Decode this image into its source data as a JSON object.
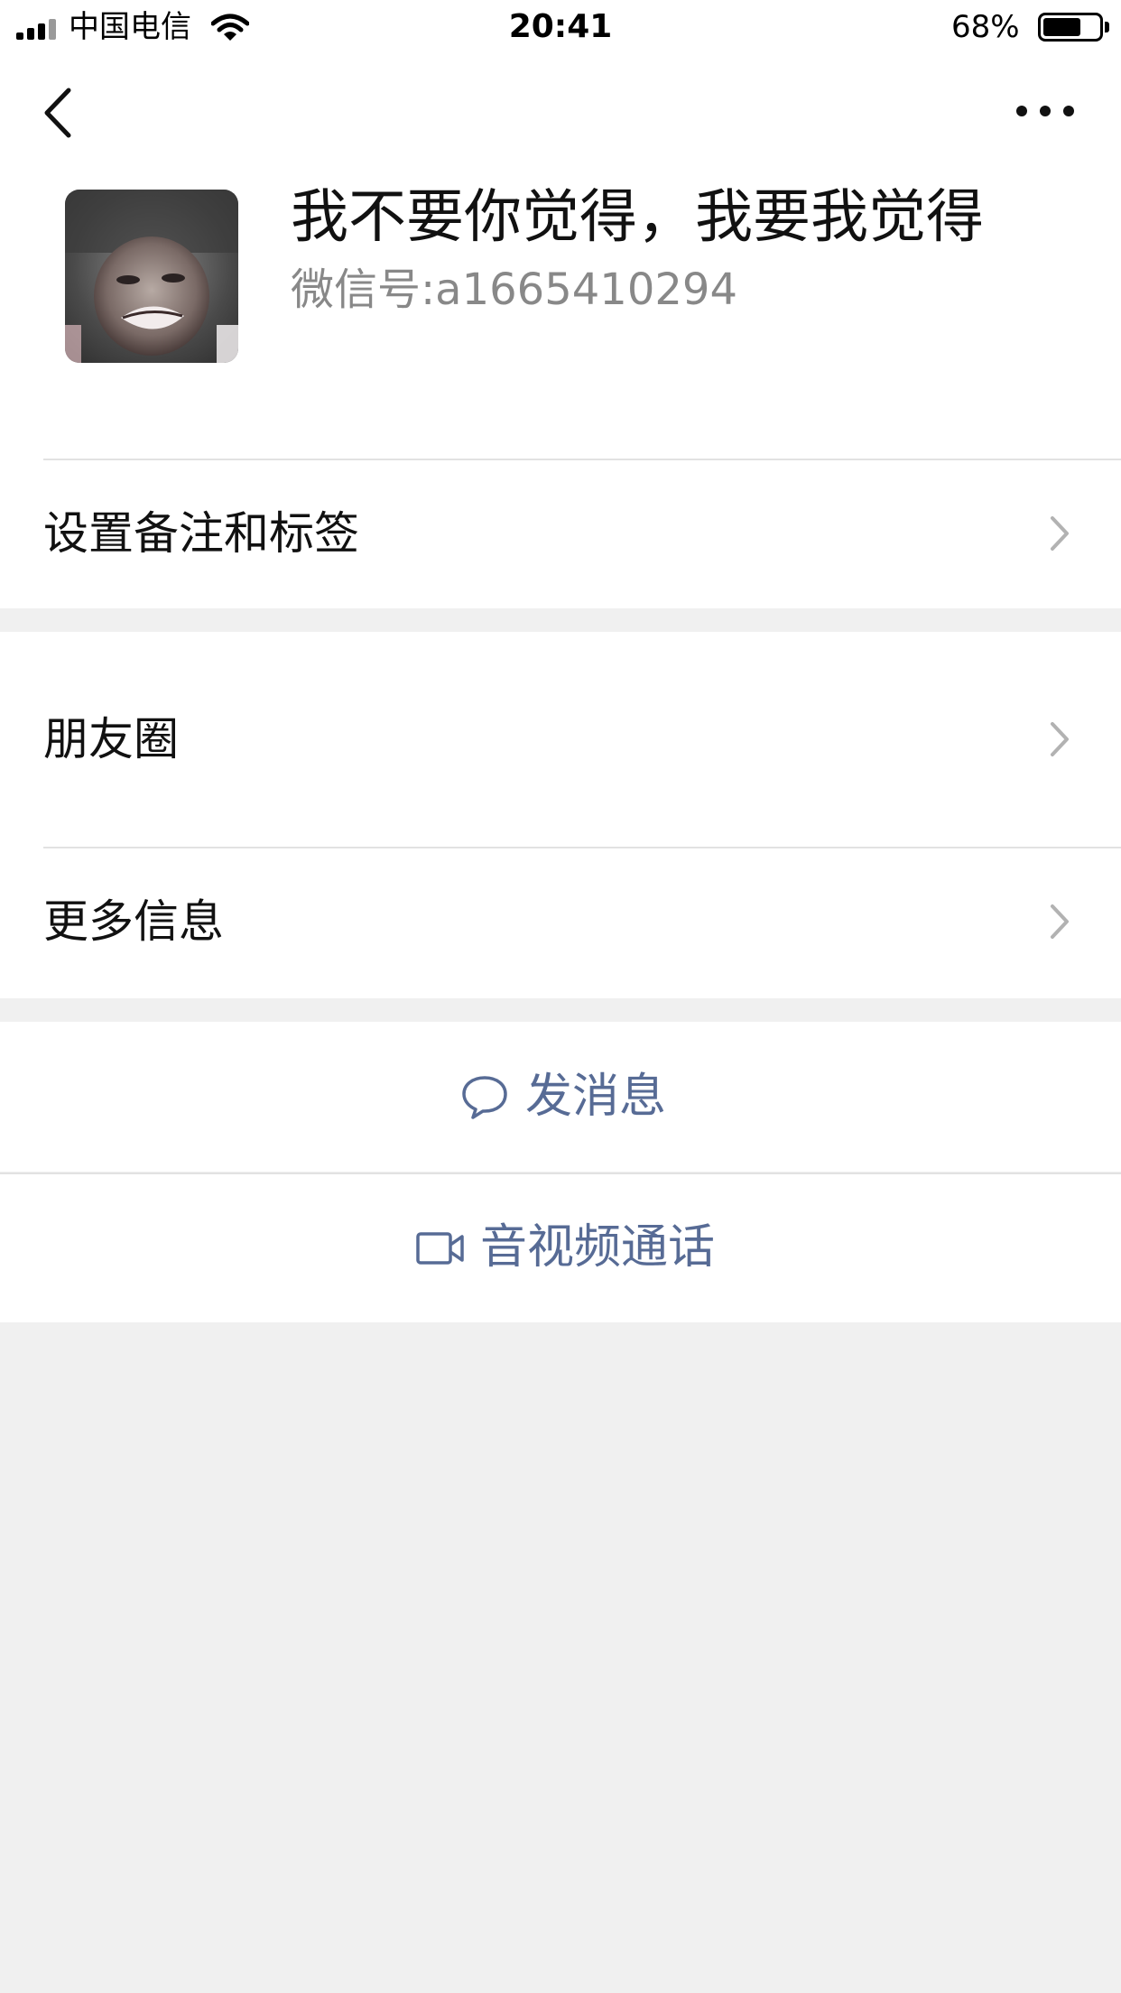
{
  "status_bar": {
    "carrier": "中国电信",
    "time": "20:41",
    "battery_text": "68%",
    "battery_level": 0.68
  },
  "nav": {
    "back_icon": "chevron-left-icon",
    "more_icon": "ellipsis-icon"
  },
  "profile": {
    "nickname": "我不要你觉得，我要我觉得",
    "wechat_id": "微信号:a1665410294"
  },
  "menu": {
    "remark_tags": "设置备注和标签",
    "moments": "朋友圈",
    "more_info": "更多信息"
  },
  "actions": {
    "send_message": "发消息",
    "av_call": "音视频通话"
  },
  "colors": {
    "link": "#576b95",
    "background": "#f0f0f0",
    "card": "#ffffff"
  }
}
